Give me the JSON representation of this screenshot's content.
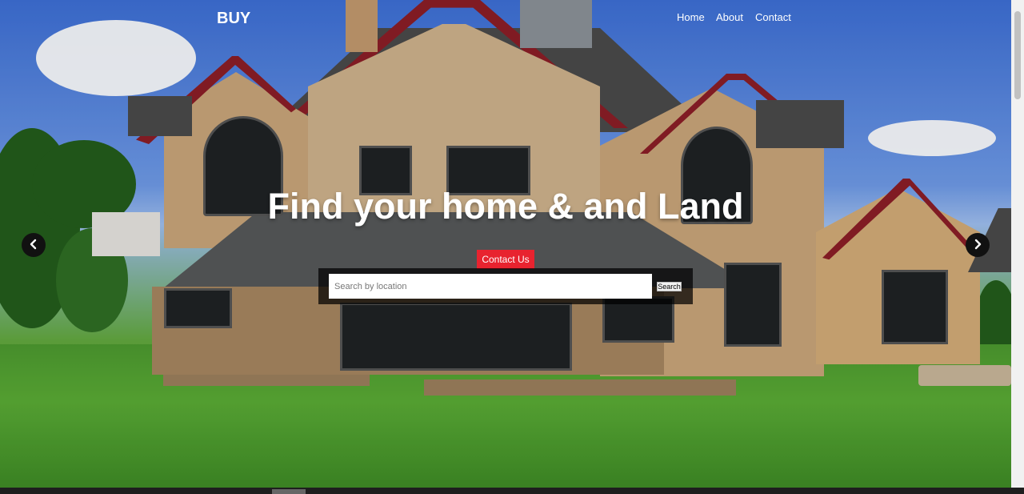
{
  "navbar": {
    "brand": "BUY",
    "links": [
      "Home",
      "About",
      "Contact"
    ]
  },
  "hero": {
    "headline": "Find your home & and Land",
    "contact_button": "Contact Us",
    "search": {
      "placeholder": "Search by location",
      "value": "",
      "button_label": "Search"
    }
  },
  "carousel": {
    "prev_icon": "chevron-left-icon",
    "next_icon": "chevron-right-icon"
  },
  "colors": {
    "accent": "#e8232f",
    "search_overlay": "#000000",
    "text": "#ffffff"
  }
}
